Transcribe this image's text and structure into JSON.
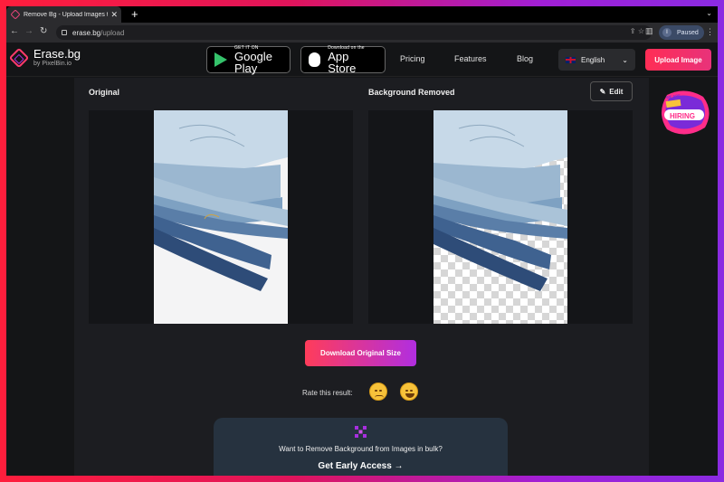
{
  "browser": {
    "tab_title": "Remove Bg - Upload Images to",
    "tab_close": "✕",
    "new_tab": "+",
    "url_domain": "erase.bg",
    "url_path": "/upload",
    "profile_initial": "I",
    "profile_status": "Paused"
  },
  "header": {
    "logo_name": "Erase.bg",
    "logo_by": "by PixelBin.io",
    "google_play_small": "GET IT ON",
    "google_play_big": "Google Play",
    "app_store_small": "Download on the",
    "app_store_big": "App Store",
    "nav": [
      "Pricing",
      "Features",
      "Blog"
    ],
    "language": "English",
    "upload_button": "Upload Image"
  },
  "main": {
    "original_title": "Original",
    "removed_title": "Background Removed",
    "edit_button": "Edit",
    "download_button": "Download Original Size",
    "rate_label": "Rate this result:",
    "bulk_text": "Want to Remove Background from Images in bulk?",
    "bulk_cta": "Get Early Access →"
  },
  "badge": {
    "top": "WE ARE",
    "main": "HIRING"
  },
  "colors": {
    "accent": "#ff2d55",
    "accent_purple": "#a72ee0",
    "bulk_card": "#26323f"
  }
}
